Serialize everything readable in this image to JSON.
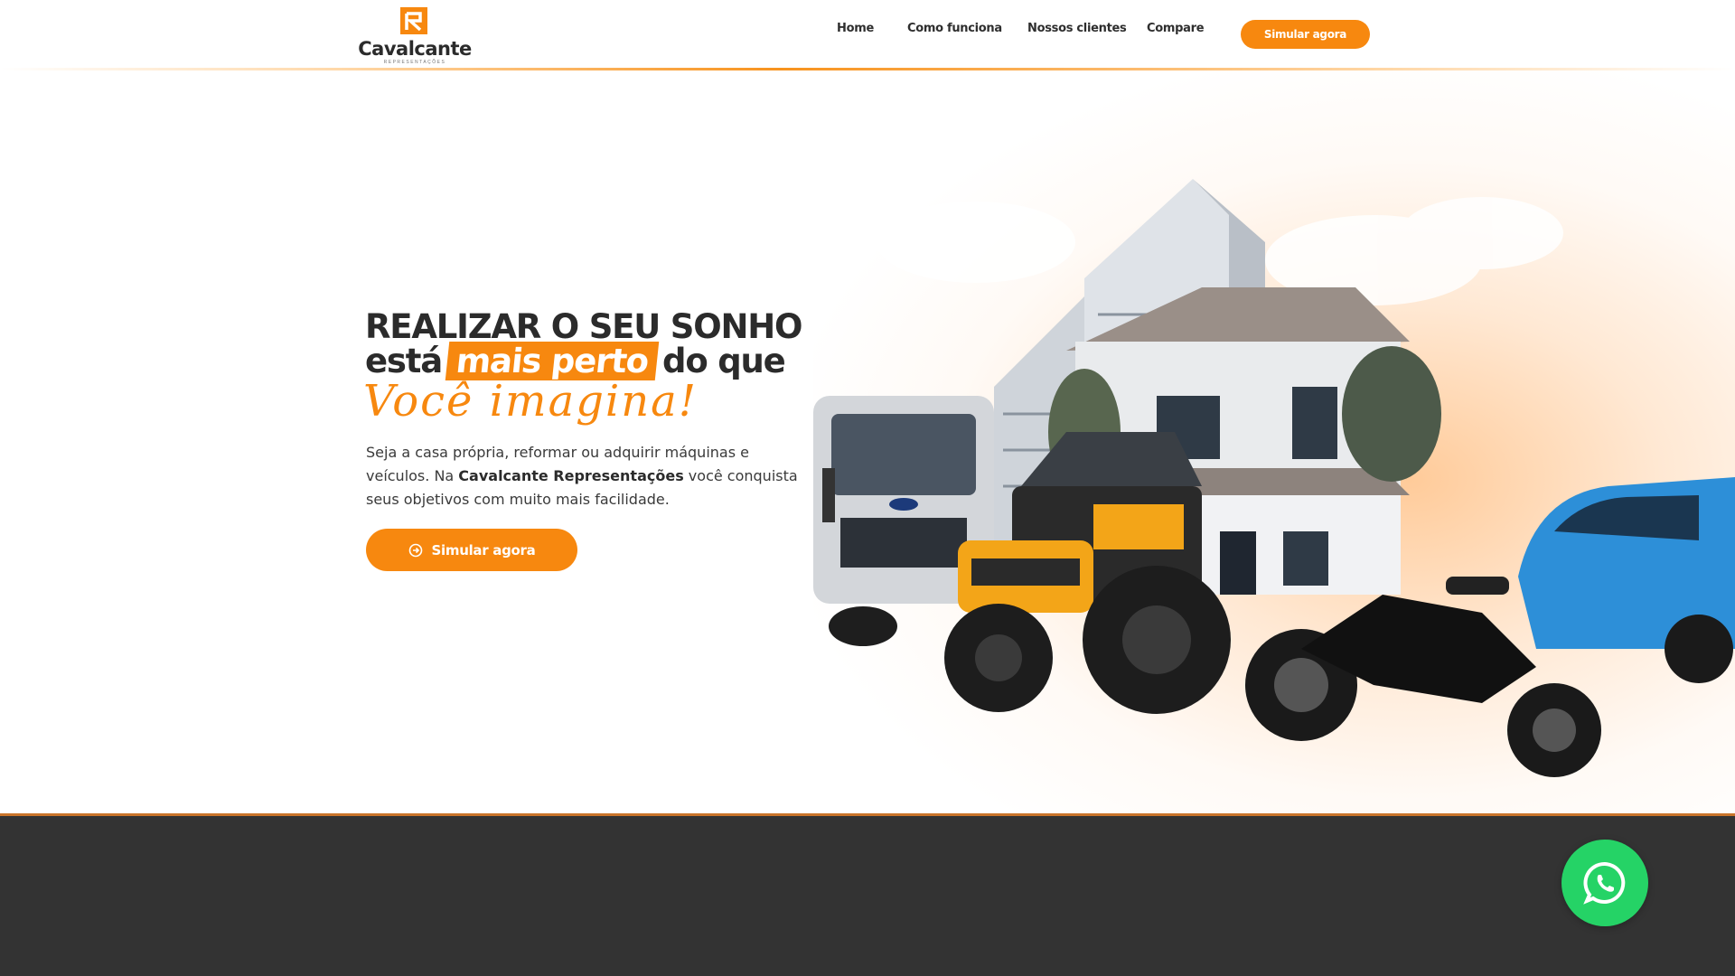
{
  "brand": {
    "name": "Cavalcante",
    "tagline": "REPRESENTAÇÕES",
    "accent_color": "#f7880f",
    "dark_color": "#333333"
  },
  "nav": {
    "items": [
      {
        "label": "Home"
      },
      {
        "label": "Como funciona"
      },
      {
        "label": "Nossos clientes"
      },
      {
        "label": "Compare"
      }
    ],
    "cta_label": "Simular agora"
  },
  "hero": {
    "headline_line1": "REALIZAR O SEU SONHO",
    "headline_pre": "está",
    "headline_highlight": "mais perto",
    "headline_post": "do que",
    "headline_script": "Você  imagina!",
    "lead_pre": "Seja a casa própria, reformar ou adquirir máquinas e veículos. Na ",
    "lead_bold": "Cavalcante Representações",
    "lead_post": " você conquista seus objetivos com muito mais facilidade.",
    "cta_label": "Simular agora",
    "cta_icon": "arrow-circle-right-icon",
    "illustration": [
      "building",
      "house",
      "truck",
      "tractor",
      "motorcycle",
      "car"
    ]
  },
  "whatsapp": {
    "icon": "whatsapp-icon",
    "color": "#25d366"
  }
}
